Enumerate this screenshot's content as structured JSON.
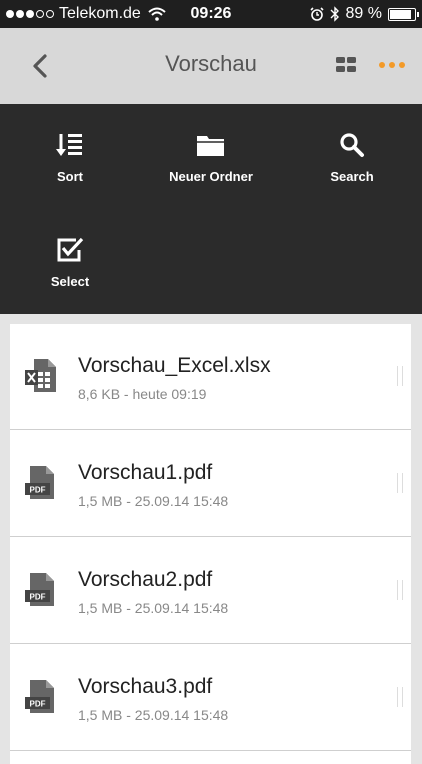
{
  "status": {
    "carrier": "Telekom.de",
    "time": "09:26",
    "battery_text": "89 %",
    "battery_level": 0.89
  },
  "nav": {
    "title": "Vorschau",
    "accent": "#f39a28"
  },
  "toolbar": {
    "sort": "Sort",
    "new_folder": "Neuer Ordner",
    "search": "Search",
    "select": "Select"
  },
  "files": [
    {
      "name": "Vorschau_Excel.xlsx",
      "meta": "8,6 KB - heute 09:19",
      "icon": "excel-file-icon"
    },
    {
      "name": "Vorschau1.pdf",
      "meta": "1,5 MB - 25.09.14 15:48",
      "icon": "pdf-file-icon"
    },
    {
      "name": "Vorschau2.pdf",
      "meta": "1,5 MB - 25.09.14 15:48",
      "icon": "pdf-file-icon"
    },
    {
      "name": "Vorschau3.pdf",
      "meta": "1,5 MB - 25.09.14 15:48",
      "icon": "pdf-file-icon"
    }
  ],
  "pdf_badge": "PDF"
}
